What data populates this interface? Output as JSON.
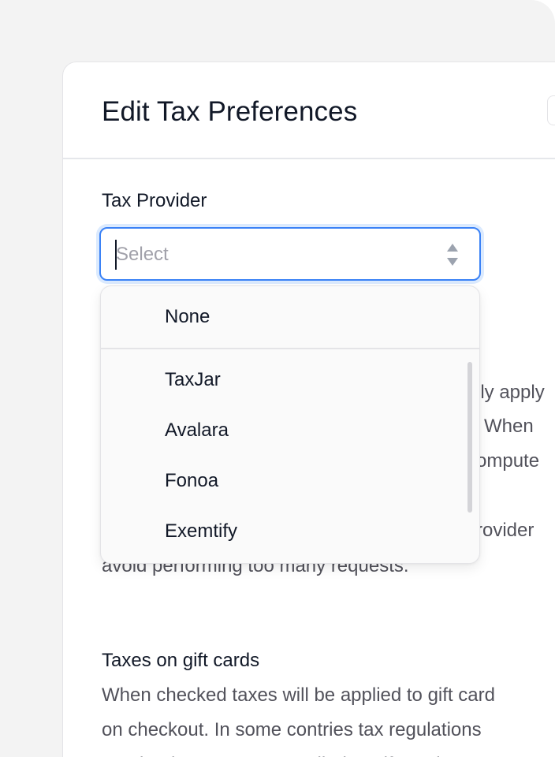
{
  "modal": {
    "title": "Edit Tax Preferences"
  },
  "tax_provider": {
    "label": "Tax Provider",
    "placeholder": "Select",
    "options": [
      {
        "label": "None"
      },
      {
        "label": "TaxJar"
      },
      {
        "label": "Avalara"
      },
      {
        "label": "Fonoa"
      },
      {
        "label": "Exemtify"
      }
    ]
  },
  "provider_description": {
    "lines": [
      "lly apply",
      "When",
      "ompute",
      "rovider",
      "avoid performing too many requests."
    ]
  },
  "gift_cards": {
    "title": "Taxes on gift cards",
    "lines": [
      "When checked taxes will be applied to gift card",
      "on checkout. In some contries tax regulations",
      "require that taxes are applied to gift cards on"
    ]
  },
  "icons": {
    "select_arrows": "updown-chevron-icon"
  }
}
